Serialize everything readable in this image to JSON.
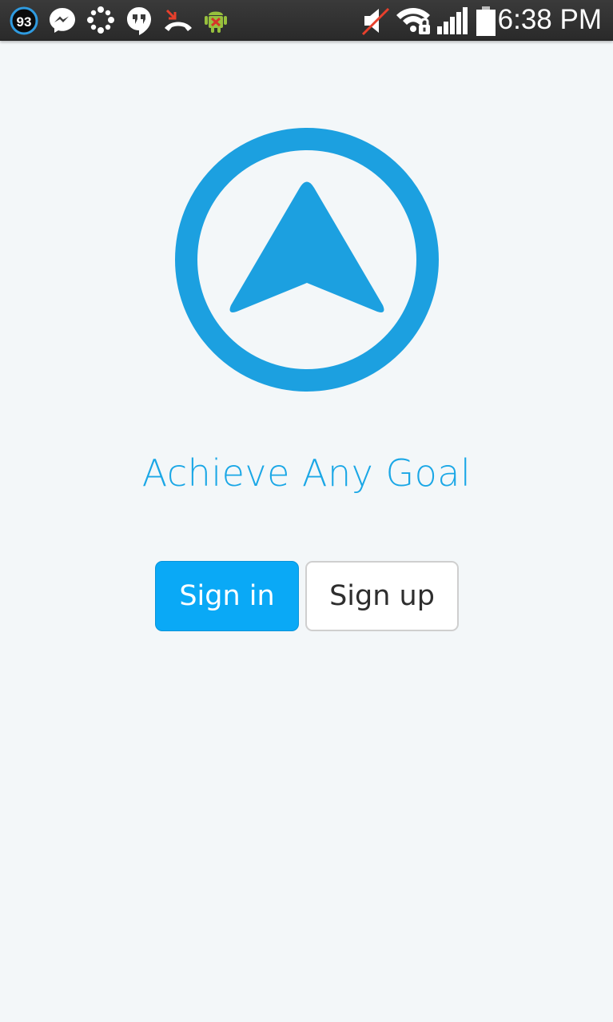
{
  "status_bar": {
    "notification_badge_count": "93",
    "icons": {
      "badge": "battery-percent-badge-icon",
      "messenger": "messenger-icon",
      "dots": "dots-app-icon",
      "hangouts": "hangouts-icon",
      "missed_call": "missed-call-icon",
      "android": "android-debug-icon",
      "mute": "muted-speaker-icon",
      "wifi": "wifi-locked-icon",
      "signal": "cell-signal-icon",
      "battery": "battery-icon"
    },
    "time": "6:38 PM"
  },
  "logo": {
    "icon": "navigation-arrow-logo-icon",
    "color": "#1ca0e0"
  },
  "tagline": "Achieve Any Goal",
  "buttons": {
    "signin_label": "Sign in",
    "signup_label": "Sign up"
  },
  "colors": {
    "accent": "#0aa9f6",
    "tagline": "#1aa7e6",
    "background": "#f3f7f9"
  }
}
